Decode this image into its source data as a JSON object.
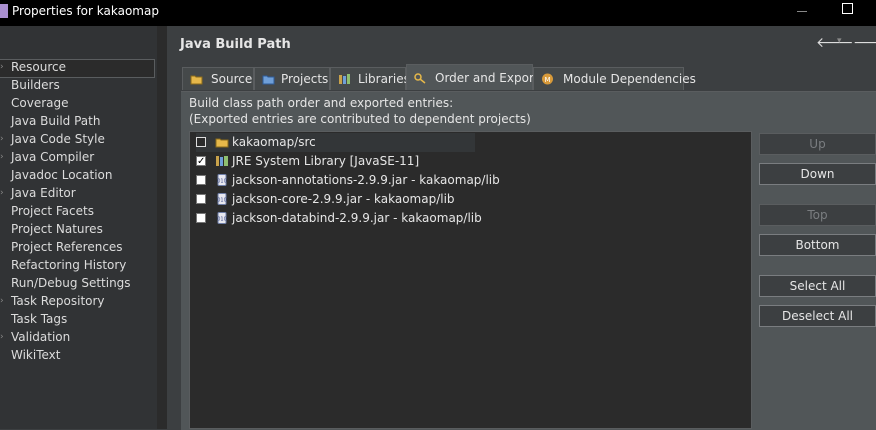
{
  "window": {
    "title": "Properties for kakaomap"
  },
  "page": {
    "title": "Java Build Path"
  },
  "sidebar": {
    "items": [
      {
        "label": "Resource",
        "expandable": true
      },
      {
        "label": "Builders",
        "expandable": false
      },
      {
        "label": "Coverage",
        "expandable": false
      },
      {
        "label": "Java Build Path",
        "expandable": false
      },
      {
        "label": "Java Code Style",
        "expandable": true
      },
      {
        "label": "Java Compiler",
        "expandable": true
      },
      {
        "label": "Javadoc Location",
        "expandable": false
      },
      {
        "label": "Java Editor",
        "expandable": true
      },
      {
        "label": "Project Facets",
        "expandable": false
      },
      {
        "label": "Project Natures",
        "expandable": false
      },
      {
        "label": "Project References",
        "expandable": false
      },
      {
        "label": "Refactoring History",
        "expandable": false
      },
      {
        "label": "Run/Debug Settings",
        "expandable": false
      },
      {
        "label": "Task Repository",
        "expandable": true
      },
      {
        "label": "Task Tags",
        "expandable": false
      },
      {
        "label": "Validation",
        "expandable": true
      },
      {
        "label": "WikiText",
        "expandable": false
      }
    ]
  },
  "tabs": [
    {
      "label": "Source",
      "icon": "source-folder-icon",
      "active": false
    },
    {
      "label": "Projects",
      "icon": "projects-icon",
      "active": false
    },
    {
      "label": "Libraries",
      "icon": "libraries-icon",
      "active": false
    },
    {
      "label": "Order and Export",
      "icon": "order-export-icon",
      "active": true
    },
    {
      "label": "Module Dependencies",
      "icon": "module-icon",
      "active": false
    }
  ],
  "description": {
    "line1": "Build class path order and exported entries:",
    "line2": "(Exported entries are contributed to dependent projects)"
  },
  "entries": [
    {
      "label": "kakaomap/src",
      "checked": false,
      "icon": "source-folder-icon"
    },
    {
      "label": "JRE System Library [JavaSE-11]",
      "checked": true,
      "icon": "library-icon"
    },
    {
      "label": "jackson-annotations-2.9.9.jar - kakaomap/lib",
      "checked": false,
      "icon": "jar-icon"
    },
    {
      "label": "jackson-core-2.9.9.jar - kakaomap/lib",
      "checked": false,
      "icon": "jar-icon"
    },
    {
      "label": "jackson-databind-2.9.9.jar - kakaomap/lib",
      "checked": false,
      "icon": "jar-icon"
    }
  ],
  "buttons": {
    "up": "Up",
    "down": "Down",
    "top": "Top",
    "bottom": "Bottom",
    "select_all": "Select All",
    "deselect_all": "Deselect All"
  },
  "colors": {
    "background": "#3c3f41",
    "list_background": "#2b2b2b",
    "title_bar": "#000000"
  }
}
